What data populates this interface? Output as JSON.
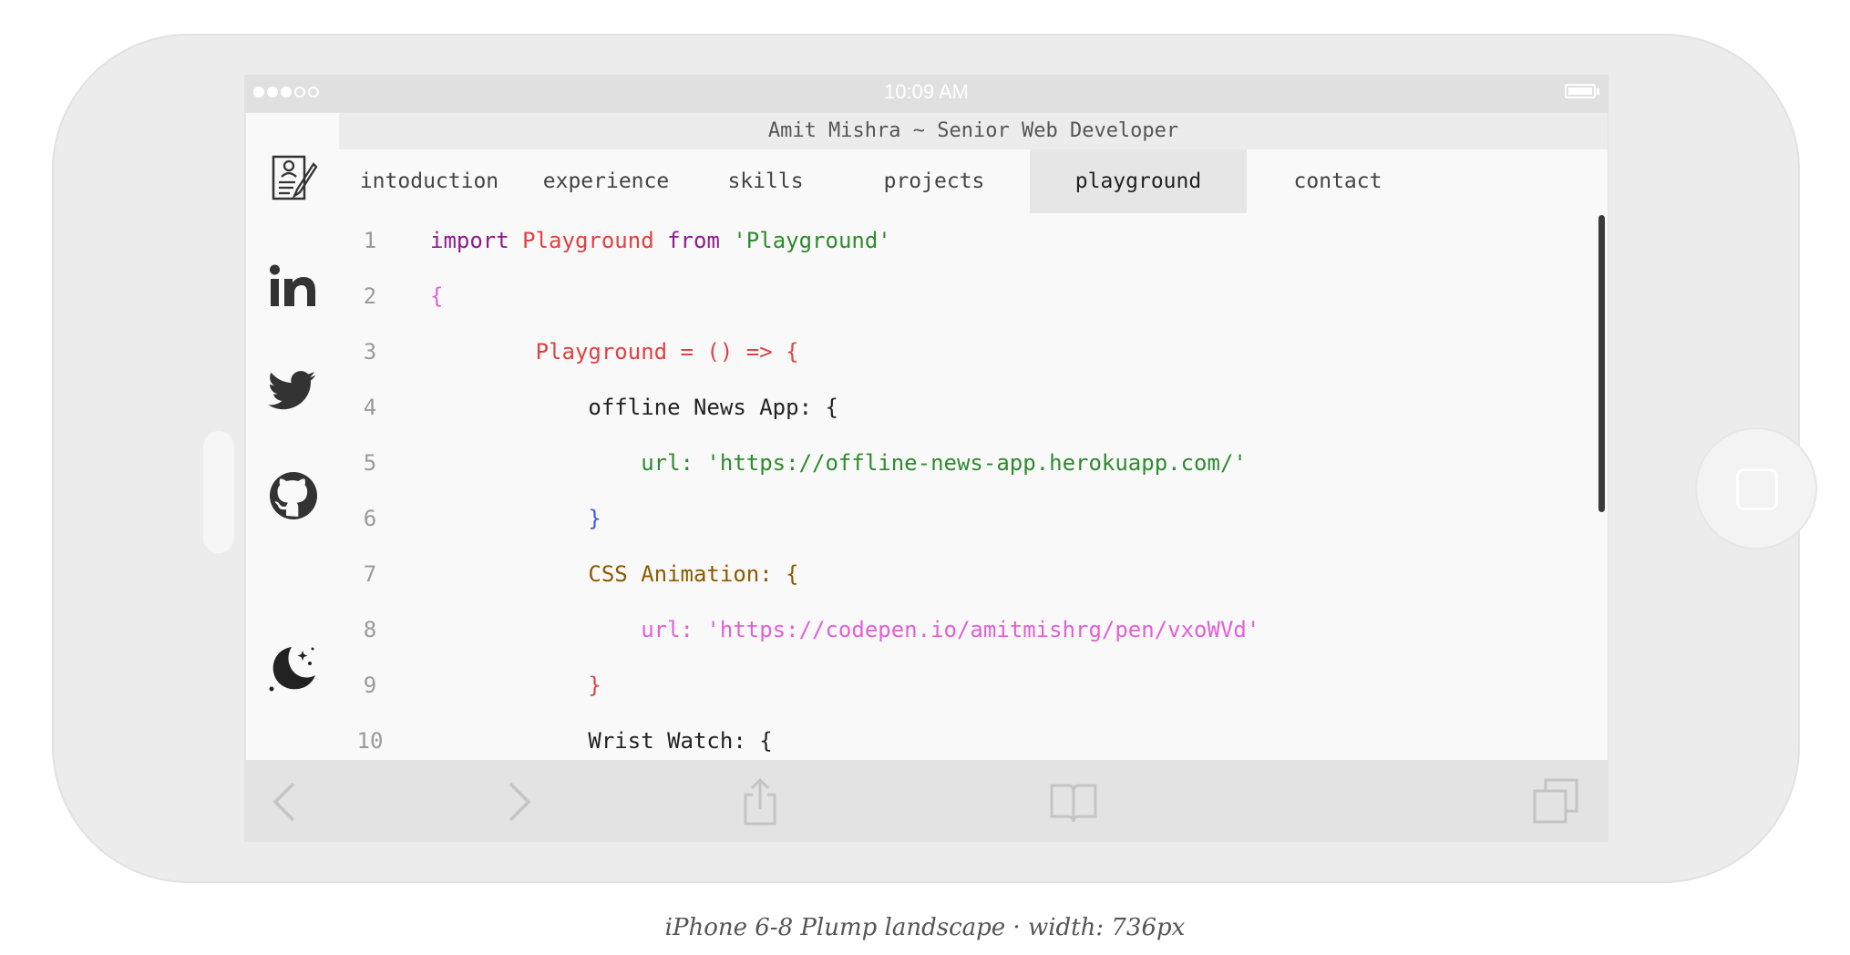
{
  "device": {
    "status_time": "10:09 AM",
    "signal_dots_filled": 3,
    "signal_dots_total": 5,
    "battery_level": 1.0
  },
  "window": {
    "title": "Amit Mishra ~ Senior Web Developer"
  },
  "sidebar": {
    "icons": [
      "resume-icon",
      "linkedin-icon",
      "twitter-icon",
      "github-icon",
      "dark-mode-moon-icon"
    ]
  },
  "tabs": [
    {
      "label": "intoduction",
      "active": false
    },
    {
      "label": "experience",
      "active": false
    },
    {
      "label": "skills",
      "active": false
    },
    {
      "label": "projects",
      "active": false
    },
    {
      "label": "playground",
      "active": true
    },
    {
      "label": "contact",
      "active": false
    }
  ],
  "code": {
    "lines": [
      {
        "num": "1",
        "tokens": [
          {
            "text": "import ",
            "color": "#8e1b8e"
          },
          {
            "text": "Playground ",
            "color": "#e04141"
          },
          {
            "text": "from ",
            "color": "#8e1b8e"
          },
          {
            "text": "'Playground'",
            "color": "#2e8b2e"
          }
        ]
      },
      {
        "num": "2",
        "tokens": [
          {
            "text": "{",
            "color": "#e35fd6"
          }
        ]
      },
      {
        "num": "3",
        "tokens": [
          {
            "text": "        Playground = () => {",
            "color": "#e04141"
          }
        ]
      },
      {
        "num": "4",
        "tokens": [
          {
            "text": "            offline News App: {",
            "color": "#222222"
          }
        ]
      },
      {
        "num": "5",
        "tokens": [
          {
            "text": "                url: 'https://offline-news-app.herokuapp.com/'",
            "color": "#2e8b2e"
          }
        ]
      },
      {
        "num": "6",
        "tokens": [
          {
            "text": "            }",
            "color": "#3b5fd8"
          }
        ]
      },
      {
        "num": "7",
        "tokens": [
          {
            "text": "            CSS Animation: {",
            "color": "#8b5a00"
          }
        ]
      },
      {
        "num": "8",
        "tokens": [
          {
            "text": "                url: 'https://codepen.io/amitmishrg/pen/vxoWVd'",
            "color": "#e35fd6"
          }
        ]
      },
      {
        "num": "9",
        "tokens": [
          {
            "text": "            }",
            "color": "#e04141"
          }
        ]
      },
      {
        "num": "10",
        "tokens": [
          {
            "text": "            Wrist Watch: {",
            "color": "#222222"
          }
        ]
      }
    ]
  },
  "toolbar": {
    "buttons": [
      "back-icon",
      "forward-icon",
      "share-icon",
      "bookmarks-icon",
      "tabs-icon"
    ]
  },
  "caption": "iPhone 6-8 Plump landscape · width: 736px"
}
